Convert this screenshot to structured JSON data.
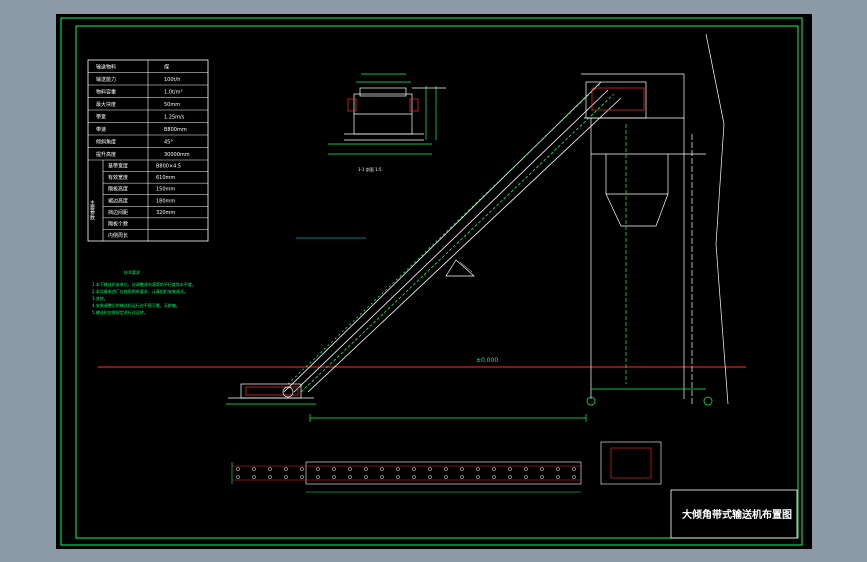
{
  "drawing": {
    "title": "大倾角带式输送机布置图",
    "elevation_label": "±0.000",
    "section_label": "1-1 剖面 1:5",
    "notes_heading": "技术要求",
    "notes": [
      "1.本下输送机安装后，应调整改向滚筒的平行度和水平度。",
      "2.本设备制造厂应按照图纸要求，认真组织安装调试。",
      "3.其他。",
      "4.安装调整后的输送机运行应平稳可靠，无跑偏。",
      "5.输送机应按规定进行试运转。"
    ]
  },
  "spec_table": {
    "rows": [
      {
        "label": "输送物料",
        "value": "煤"
      },
      {
        "label": "输送能力",
        "value": "100t/h"
      },
      {
        "label": "物料容重",
        "value": "1.0t/m³"
      },
      {
        "label": "最大块度",
        "value": "50mm"
      },
      {
        "label": "带宽",
        "value": "1.25m/s"
      },
      {
        "label": "带速",
        "value": "B800mm"
      },
      {
        "label": "倾斜角度",
        "value": "45°"
      },
      {
        "label": "提升高度",
        "value": "30000mm"
      }
    ],
    "group_label": "主要参数",
    "group_rows": [
      {
        "label": "基带宽度",
        "value": "B800×4.5"
      },
      {
        "label": "有效宽度",
        "value": "610mm"
      },
      {
        "label": "隔板高度",
        "value": "150mm"
      },
      {
        "label": "裙边高度",
        "value": "180mm"
      },
      {
        "label": "挡边间距",
        "value": "320mm"
      },
      {
        "label": "隔板个数",
        "value": ""
      },
      {
        "label": "内侧周长",
        "value": ""
      }
    ]
  },
  "colors": {
    "frame": "#00ff66",
    "lines": "#ffffff",
    "accent": "#ff2a2a",
    "dims": "#00ff66",
    "background": "#000000"
  }
}
